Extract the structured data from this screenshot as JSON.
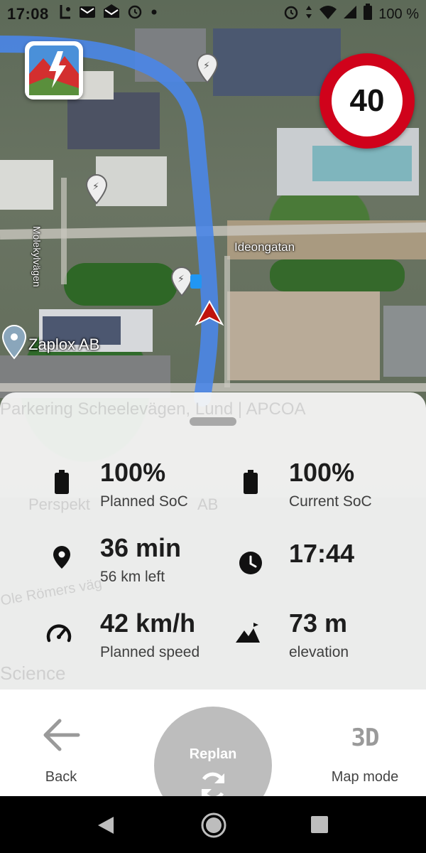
{
  "status_bar": {
    "time": "17:08",
    "battery_text": "100 %",
    "left_icons": [
      "sim-icon",
      "mail-icon",
      "mail-open-icon",
      "alarm-icon",
      "dot-icon"
    ],
    "right_icons": [
      "alarm-icon",
      "data-arrows-icon",
      "wifi-icon",
      "signal-icon",
      "battery-icon"
    ]
  },
  "map": {
    "speed_limit": "40",
    "place_label": "Zaplox AB",
    "street_labels": [
      "Ideongatan",
      "Molekylvägen"
    ],
    "route_color": "#4a86e8",
    "marker_color": "#c0140c"
  },
  "sheet": {
    "ghost_labels": [
      "Parkering Scheelevägen, Lund | APCOA",
      "Perspekt",
      "AB",
      "Ole Römers väg",
      "Science"
    ],
    "stats": [
      {
        "icon": "battery-icon",
        "value": "100%",
        "label": "Planned SoC"
      },
      {
        "icon": "battery-icon",
        "value": "100%",
        "label": "Current SoC"
      },
      {
        "icon": "location-pin-icon",
        "value": "36 min",
        "label": "56 km left"
      },
      {
        "icon": "clock-icon",
        "value": "17:44",
        "label": ""
      },
      {
        "icon": "speedometer-icon",
        "value": "42 km/h",
        "label": "Planned speed"
      },
      {
        "icon": "mountain-icon",
        "value": "73 m",
        "label": "elevation"
      }
    ]
  },
  "actions": {
    "back_label": "Back",
    "replan_label": "Replan",
    "map_mode_label": "Map mode",
    "map_mode_icon_text": "3D"
  },
  "colors": {
    "speed_sign_red": "#d0021b",
    "replan_gray": "#bdbdbd"
  }
}
